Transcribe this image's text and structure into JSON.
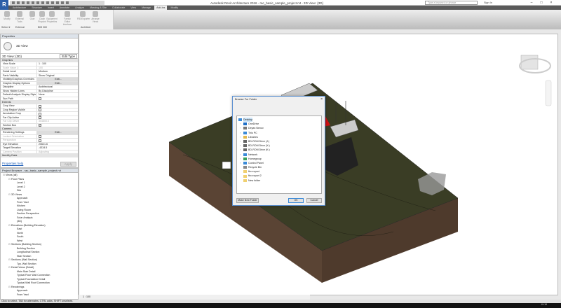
{
  "app": {
    "title": "Autodesk Revit Architecture 2016 -   rac_basic_sample_project.rvt - 3D View: {3D}",
    "search_placeholder": "Type a keyword or phrase",
    "sign_in": "Sign In",
    "logo": "R"
  },
  "ribbon": {
    "tabs": [
      "Architecture",
      "Structure",
      "Insert",
      "Annotate",
      "Analyze",
      "Massing & Site",
      "Collaborate",
      "View",
      "Manage",
      "Add-Ins",
      "Modify"
    ],
    "active_tab": "Add-Ins",
    "buttons": [
      "Modify",
      "External Tools",
      "Glue",
      "Clash Pinpoint",
      "Equipment Properties",
      "Family Editor Interface",
      "FBXExporter",
      "Arrange Views"
    ],
    "panels": [
      "Select ▾",
      "External",
      "BIM 360",
      "Architizer"
    ]
  },
  "properties": {
    "header": "Properties",
    "type_name": "3D View",
    "selector": "3D View: {3D}",
    "edit_type": "Edit Type",
    "groups": [
      {
        "name": "Graphics",
        "rows": [
          [
            "View Scale",
            "1 : 100"
          ],
          [
            "Scale Value    1:",
            "100"
          ],
          [
            "Detail Level",
            "Medium"
          ],
          [
            "Parts Visibility",
            "Show Original"
          ],
          [
            "Visibility/Graphics Overrides",
            "Edit..."
          ],
          [
            "Graphic Display Options",
            "Edit..."
          ],
          [
            "Discipline",
            "Architectural"
          ],
          [
            "Show Hidden Lines",
            "By Discipline"
          ],
          [
            "Default Analysis Display Style",
            "None"
          ],
          [
            "Sun Path",
            ""
          ]
        ]
      },
      {
        "name": "Extents",
        "rows": [
          [
            "Crop View",
            ""
          ],
          [
            "Crop Region Visible",
            ""
          ],
          [
            "Annotation Crop",
            ""
          ],
          [
            "Far Clip Active",
            ""
          ],
          [
            "Far Clip Offset",
            "304800.0"
          ],
          [
            "Section Box",
            "✓"
          ]
        ]
      },
      {
        "name": "Camera",
        "rows": [
          [
            "Rendering Settings",
            "Edit..."
          ],
          [
            "Locked Orientation",
            ""
          ],
          [
            "Perspective",
            ""
          ],
          [
            "Eye Elevation",
            "20621.6"
          ],
          [
            "Target Elevation",
            "-4334.5"
          ],
          [
            "Camera Position",
            "Adjusting"
          ]
        ]
      },
      {
        "name": "Identity Data",
        "rows": []
      }
    ],
    "help": "Properties help",
    "apply": "Apply"
  },
  "browser": {
    "header": "Project Browser - rac_basic_sample_project.rvt",
    "items": [
      [
        0,
        "Views (all)"
      ],
      [
        1,
        "Floor Plans"
      ],
      [
        2,
        "Level 1"
      ],
      [
        2,
        "Level 2"
      ],
      [
        2,
        "Site"
      ],
      [
        1,
        "3D Views"
      ],
      [
        2,
        "Approach"
      ],
      [
        2,
        "From Yard"
      ],
      [
        2,
        "Kitchen"
      ],
      [
        2,
        "Living Room"
      ],
      [
        2,
        "Section Perspective"
      ],
      [
        2,
        "Solar Analysis"
      ],
      [
        2,
        "{3D}"
      ],
      [
        1,
        "Elevations (Building Elevation)"
      ],
      [
        2,
        "East"
      ],
      [
        2,
        "North"
      ],
      [
        2,
        "South"
      ],
      [
        2,
        "West"
      ],
      [
        1,
        "Sections (Building Section)"
      ],
      [
        2,
        "Building Section"
      ],
      [
        2,
        "Longitudinal Section"
      ],
      [
        2,
        "Stair Section"
      ],
      [
        1,
        "Sections (Wall Section)"
      ],
      [
        2,
        "Typ. Wall Section"
      ],
      [
        1,
        "Detail Views (Detail)"
      ],
      [
        2,
        "Main Stair Detail"
      ],
      [
        2,
        "Typical Floor Wall Connection"
      ],
      [
        2,
        "Typical Foundation Detail"
      ],
      [
        2,
        "Typical Wall Roof Connection"
      ],
      [
        1,
        "Renderings"
      ],
      [
        2,
        "Approach"
      ],
      [
        2,
        "From Yard"
      ]
    ]
  },
  "dialog": {
    "title": "Browse For Folder",
    "close": "×",
    "items": [
      {
        "label": "Desktop",
        "icon": "desktop-icon",
        "color": "#3a8ad8"
      },
      {
        "label": "OneDrive",
        "icon": "cloud-icon",
        "color": "#1e6fc8"
      },
      {
        "label": "Deyan Nenov",
        "icon": "user-icon",
        "color": "#777"
      },
      {
        "label": "This PC",
        "icon": "computer-icon",
        "color": "#3a8ad8"
      },
      {
        "label": "Libraries",
        "icon": "library-icon",
        "color": "#e2b84c"
      },
      {
        "label": "BD-ROM Drive (J:)",
        "icon": "drive-icon",
        "color": "#666"
      },
      {
        "label": "BD-ROM Drive (X:)",
        "icon": "drive-icon",
        "color": "#666"
      },
      {
        "label": "BD-ROM Drive (K:)",
        "icon": "drive-icon",
        "color": "#666"
      },
      {
        "label": "Network",
        "icon": "network-icon",
        "color": "#3a8ad8"
      },
      {
        "label": "Homegroup",
        "icon": "homegroup-icon",
        "color": "#3aa05a"
      },
      {
        "label": "Control Panel",
        "icon": "control-panel-icon",
        "color": "#3a8ad8"
      },
      {
        "label": "Recycle Bin",
        "icon": "recycle-bin-icon",
        "color": "#888"
      },
      {
        "label": "fbx export",
        "icon": "folder-icon",
        "color": "#f0d070"
      },
      {
        "label": "fbx export 2",
        "icon": "folder-icon",
        "color": "#f0d070"
      },
      {
        "label": "New folder",
        "icon": "folder-icon",
        "color": "#f0d070"
      }
    ],
    "make_new_folder": "Make New Folder",
    "ok": "OK",
    "cancel": "Cancel"
  },
  "viewbar": {
    "scale": "1 : 100"
  },
  "statusbar": {
    "text": "Click to select, TAB for alternates, CTRL adds, SHIFT unselects.",
    "model": "Main Model",
    "time": "19:18"
  },
  "colors": {
    "terrain_top": "#3a3d25",
    "terrain_side": "#5a4434",
    "roof_red": "#d01010"
  }
}
